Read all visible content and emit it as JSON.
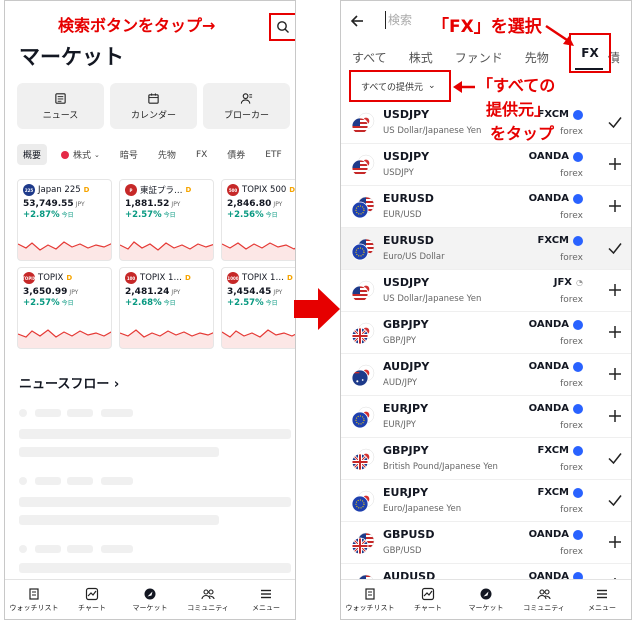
{
  "left": {
    "title": "マーケット",
    "quick_buttons": [
      {
        "label": "ニュース",
        "icon": "news-icon"
      },
      {
        "label": "カレンダー",
        "icon": "calendar-icon"
      },
      {
        "label": "ブローカー",
        "icon": "broker-icon"
      }
    ],
    "chips": [
      "概要",
      "株式",
      "暗号",
      "先物",
      "FX",
      "債券",
      "ETF"
    ],
    "cards": [
      {
        "name": "Japan 225",
        "badge": "225",
        "badge_color": "#1e3a8a",
        "delay": "D",
        "price": "53,749.55",
        "unit": "JPY",
        "change": "+2.87%",
        "period": "今日"
      },
      {
        "name": "東証プラ…",
        "badge": "P",
        "badge_color": "#c62828",
        "delay": "D",
        "price": "1,881.52",
        "unit": "JPY",
        "change": "+2.57%",
        "period": "今日"
      },
      {
        "name": "TOPIX 500",
        "badge": "500",
        "badge_color": "#c62828",
        "delay": "D",
        "price": "2,846.80",
        "unit": "JPY",
        "change": "+2.56%",
        "period": "今日"
      },
      {
        "name": "TOPIX",
        "badge": "TOPIX",
        "badge_color": "#c62828",
        "delay": "D",
        "price": "3,650.99",
        "unit": "JPY",
        "change": "+2.57%",
        "period": "今日"
      },
      {
        "name": "TOPIX 1…",
        "badge": "100",
        "badge_color": "#c62828",
        "delay": "D",
        "price": "2,481.24",
        "unit": "JPY",
        "change": "+2.68%",
        "period": "今日"
      },
      {
        "name": "TOPIX 1…",
        "badge": "1000",
        "badge_color": "#c62828",
        "delay": "D",
        "price": "3,454.45",
        "unit": "JPY",
        "change": "+2.57%",
        "period": "今日"
      }
    ],
    "news_flow": "ニュースフロー ›"
  },
  "right": {
    "search_placeholder": "検索",
    "tabs": [
      "すべて",
      "株式",
      "ファンド",
      "先物",
      "FX",
      "債"
    ],
    "active_tab": "FX",
    "provider_filter": "すべての提供元",
    "rows": [
      {
        "symbol": "USDJPY",
        "desc": "US Dollar/Japanese Yen",
        "provider": "FXCM",
        "type": "forex",
        "action": "check",
        "flag": "us-jp",
        "highlight": false
      },
      {
        "symbol": "USDJPY",
        "desc": "USDJPY",
        "provider": "OANDA",
        "type": "forex",
        "action": "plus",
        "flag": "us-jp",
        "highlight": false
      },
      {
        "symbol": "EURUSD",
        "desc": "EUR/USD",
        "provider": "OANDA",
        "type": "forex",
        "action": "plus",
        "flag": "eu-us",
        "highlight": false
      },
      {
        "symbol": "EURUSD",
        "desc": "Euro/US Dollar",
        "provider": "FXCM",
        "type": "forex",
        "action": "check",
        "flag": "eu-us",
        "highlight": true
      },
      {
        "symbol": "USDJPY",
        "desc": "US Dollar/Japanese Yen",
        "provider": "JFX",
        "type": "forex",
        "action": "plus",
        "flag": "us-jp",
        "highlight": false
      },
      {
        "symbol": "GBPJPY",
        "desc": "GBP/JPY",
        "provider": "OANDA",
        "type": "forex",
        "action": "plus",
        "flag": "gb-jp",
        "highlight": false
      },
      {
        "symbol": "AUDJPY",
        "desc": "AUD/JPY",
        "provider": "OANDA",
        "type": "forex",
        "action": "plus",
        "flag": "au-jp",
        "highlight": false
      },
      {
        "symbol": "EURJPY",
        "desc": "EUR/JPY",
        "provider": "OANDA",
        "type": "forex",
        "action": "plus",
        "flag": "eu-jp",
        "highlight": false
      },
      {
        "symbol": "GBPJPY",
        "desc": "British Pound/Japanese Yen",
        "provider": "FXCM",
        "type": "forex",
        "action": "check",
        "flag": "gb-jp",
        "highlight": false
      },
      {
        "symbol": "EURJPY",
        "desc": "Euro/Japanese Yen",
        "provider": "FXCM",
        "type": "forex",
        "action": "check",
        "flag": "eu-jp",
        "highlight": false
      },
      {
        "symbol": "GBPUSD",
        "desc": "GBP/USD",
        "provider": "OANDA",
        "type": "forex",
        "action": "plus",
        "flag": "gb-us",
        "highlight": false
      },
      {
        "symbol": "AUDUSD",
        "desc": "",
        "provider": "OANDA",
        "type": "",
        "action": "plus",
        "flag": "au-us",
        "highlight": false
      }
    ]
  },
  "nav": [
    {
      "label": "ウォッチリスト",
      "icon": "watchlist-icon"
    },
    {
      "label": "チャート",
      "icon": "chart-icon"
    },
    {
      "label": "マーケット",
      "icon": "markets-icon"
    },
    {
      "label": "コミュニティ",
      "icon": "community-icon"
    },
    {
      "label": "メニュー",
      "icon": "menu-icon"
    }
  ],
  "annotations": {
    "search": "検索ボタンをタップ→",
    "fx": "「FX」を選択",
    "provider_1": "「すべての",
    "provider_2": "提供元」",
    "provider_3": "をタップ"
  },
  "colors": {
    "accent_red": "#e60000",
    "positive": "#089981",
    "chart_line": "#e53935"
  }
}
